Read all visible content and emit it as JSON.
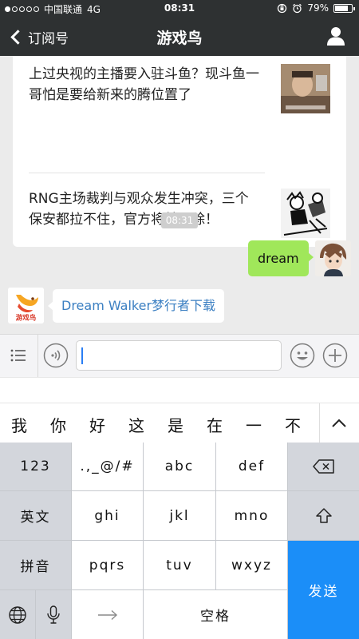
{
  "status_bar": {
    "carrier": "中国联通",
    "network": "4G",
    "time": "08:31",
    "battery": "79%",
    "battery_level": 0.79,
    "signal_bars": 1
  },
  "nav": {
    "back_label": "订阅号",
    "title": "游戏鸟"
  },
  "articles": [
    {
      "title": "上过央视的主播要入驻斗鱼？现斗鱼一哥怕是要给新来的腾位置了"
    },
    {
      "title": "RNG主场裁判与观众发生冲突，三个保安都拉不住，官方将其开除！"
    }
  ],
  "timestamp": "08:31",
  "messages": {
    "outgoing": "dream",
    "incoming": "Dream Walker梦行者下载"
  },
  "game_logo_text": "游戏鸟",
  "candidates": [
    "我",
    "你",
    "好",
    "这",
    "是",
    "在",
    "一",
    "不"
  ],
  "keyboard": {
    "k123": "123",
    "symbols": ".,_@/#",
    "abc": "abc",
    "def": "def",
    "english": "英文",
    "ghi": "ghi",
    "jkl": "jkl",
    "mno": "mno",
    "pinyin": "拼音",
    "pqrs": "pqrs",
    "tuv": "tuv",
    "wxyz": "wxyz",
    "send": "发送",
    "space": "空格"
  },
  "colors": {
    "bar": "#2e3132",
    "bubble_out": "#a0e75a",
    "link": "#3b7fc2",
    "send_key": "#1b8ef8"
  }
}
